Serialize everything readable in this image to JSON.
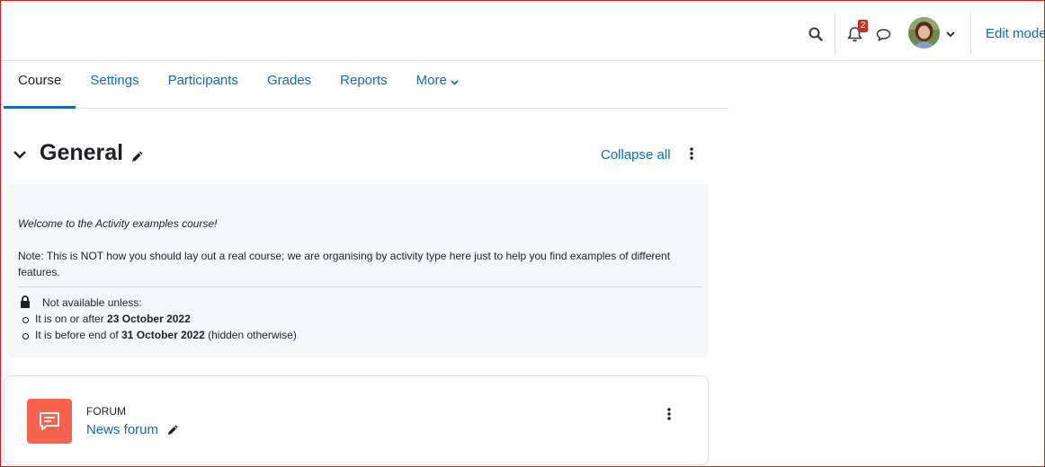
{
  "navbar": {
    "notification_count": "2",
    "edit_mode_label": "Edit mode"
  },
  "tabs": [
    {
      "label": "Course",
      "active": true
    },
    {
      "label": "Settings",
      "active": false
    },
    {
      "label": "Participants",
      "active": false
    },
    {
      "label": "Grades",
      "active": false
    },
    {
      "label": "Reports",
      "active": false
    },
    {
      "label": "More",
      "active": false
    }
  ],
  "section": {
    "title": "General",
    "collapse_all_label": "Collapse all",
    "summary": {
      "welcome": "Welcome to the Activity examples course!",
      "note": "Note: This is NOT how you should lay out a real course; we are organising by activity type here just to help you find examples of different features.",
      "restriction_heading": "Not available unless:",
      "conditions": [
        {
          "prefix": "It is on or after ",
          "date": "23 October 2022",
          "suffix": ""
        },
        {
          "prefix": "It is before end of ",
          "date": "31 October 2022",
          "suffix": " (hidden otherwise)"
        }
      ]
    }
  },
  "activity": {
    "type": "FORUM",
    "name": "News forum",
    "icon": "forum-icon",
    "icon_color": "#f7634d"
  },
  "colors": {
    "link": "#0f6cbf",
    "badge": "#ca3120",
    "frame": "#e8161b"
  }
}
